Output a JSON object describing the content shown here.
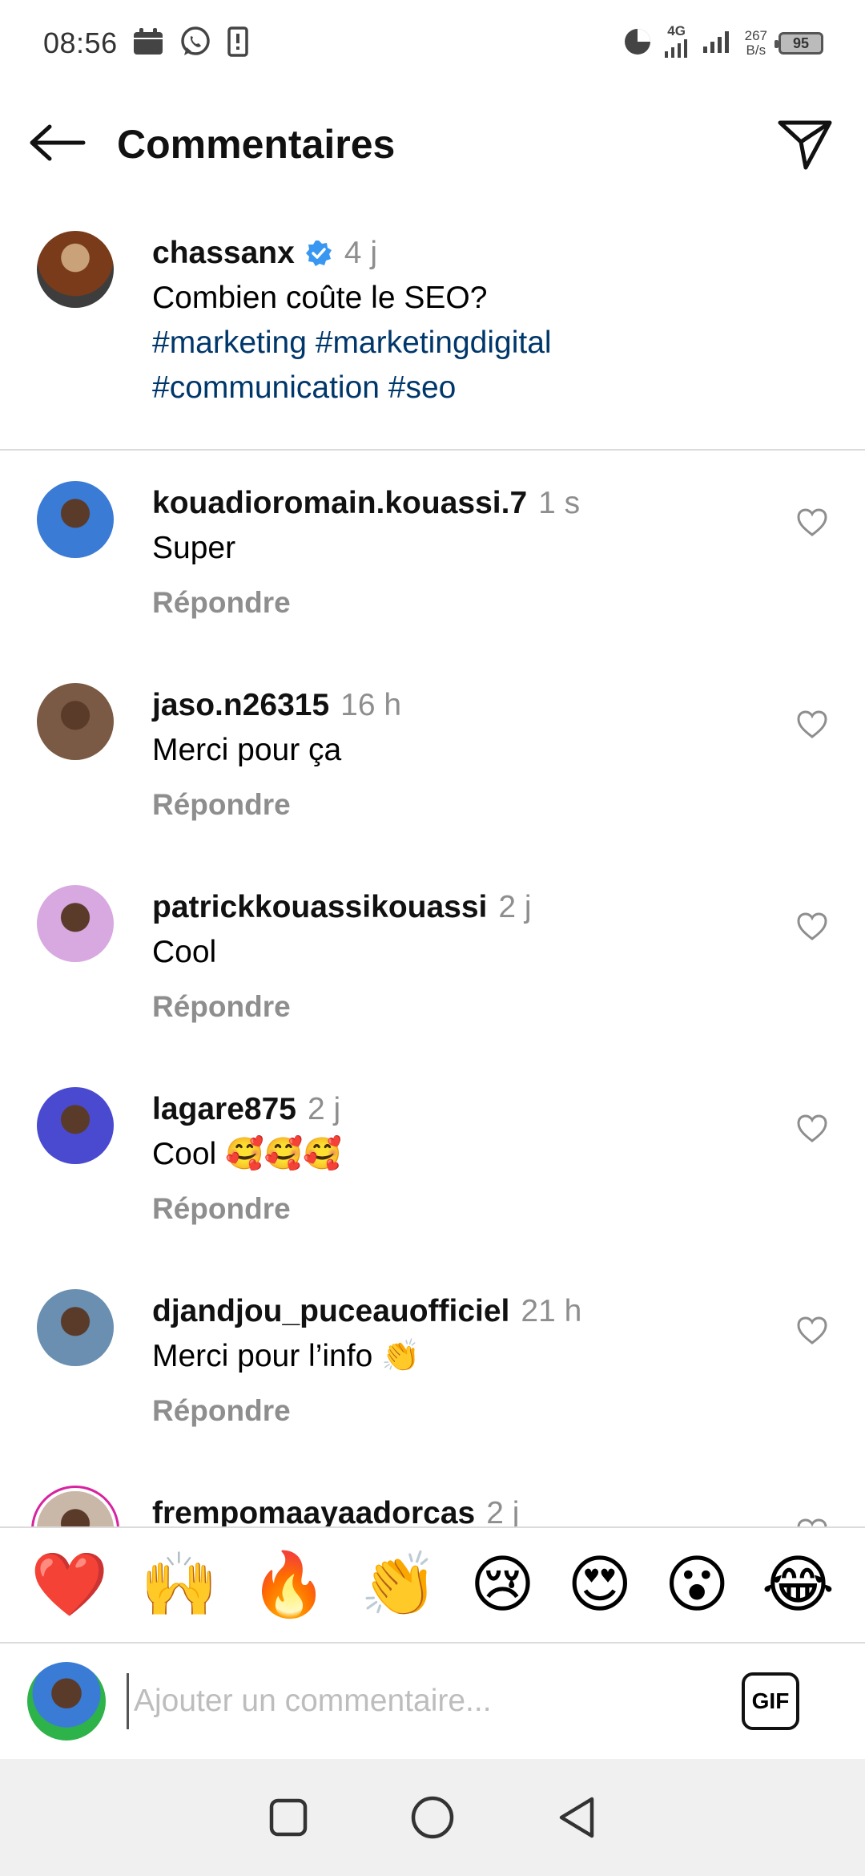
{
  "status_bar": {
    "time": "08:56",
    "network_type": "4G",
    "speed_value": "267",
    "speed_unit": "B/s",
    "battery": "95"
  },
  "header": {
    "title": "Commentaires"
  },
  "caption": {
    "username": "chassanx",
    "time": "4 j",
    "text": "Combien coûte le SEO?",
    "hashtags_line1": "#marketing #marketingdigital",
    "hashtags_line2": "#communication #seo"
  },
  "comments": [
    {
      "username": "kouadioromain.kouassi.7",
      "time": "1 s",
      "text": "Super",
      "reply": "Répondre",
      "avatar_color": "#3a7bd5"
    },
    {
      "username": "jaso.n26315",
      "time": "16 h",
      "text": "Merci pour ça",
      "reply": "Répondre",
      "avatar_color": "#7a5a44"
    },
    {
      "username": "patrickkouassikouassi",
      "time": "2 j",
      "text": "Cool",
      "reply": "Répondre",
      "avatar_color": "#d8a8e0"
    },
    {
      "username": "lagare875",
      "time": "2 j",
      "text": "Cool 🥰🥰🥰",
      "reply": "Répondre",
      "avatar_color": "#4a4ad0"
    },
    {
      "username": "djandjou_puceauofficiel",
      "time": "21 h",
      "text": "Merci pour l’info 👏",
      "reply": "Répondre",
      "avatar_color": "#6a8fb0"
    },
    {
      "username": "frempomaayaadorcas",
      "time": "2 j",
      "text": "",
      "reply": "",
      "avatar_color": "#c9b8a8"
    }
  ],
  "emoji_bar": [
    "❤️",
    "🙌",
    "🔥",
    "👏",
    "😢",
    "😍",
    "😮",
    "😂"
  ],
  "composer": {
    "placeholder": "Ajouter un commentaire...",
    "gif_label": "GIF"
  },
  "colors": {
    "hashtag": "#00376b",
    "secondary_text": "#8e8e8e",
    "verified": "#3897f0",
    "divider": "#dbdbdb"
  }
}
